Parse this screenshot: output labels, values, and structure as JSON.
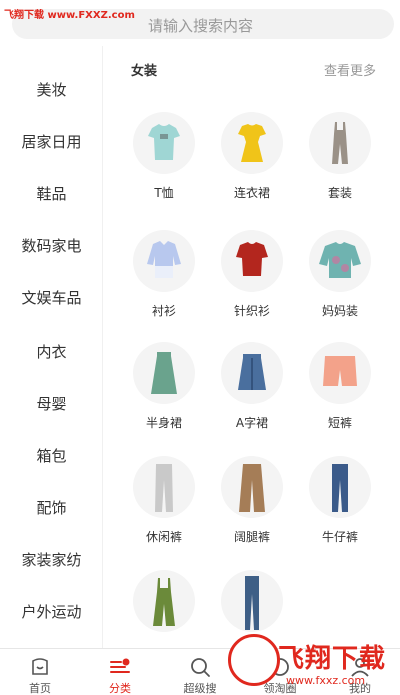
{
  "watermark": "飞翔下载 www.FXXZ.com",
  "search": {
    "placeholder": "请输入搜索内容"
  },
  "sidebar": {
    "items": [
      {
        "label": "美妆"
      },
      {
        "label": "居家日用"
      },
      {
        "label": "鞋品"
      },
      {
        "label": "数码家电"
      },
      {
        "label": "文娱车品"
      },
      {
        "label": "内衣"
      },
      {
        "label": "母婴"
      },
      {
        "label": "箱包"
      },
      {
        "label": "配饰"
      },
      {
        "label": "家装家纺"
      },
      {
        "label": "户外运动"
      }
    ]
  },
  "main": {
    "section_title": "女装",
    "more_label": "查看更多",
    "items": [
      {
        "label": "T恤",
        "icon": "tshirt-icon",
        "color": "#9fd6d4"
      },
      {
        "label": "连衣裙",
        "icon": "dress-icon",
        "color": "#f0c419"
      },
      {
        "label": "套装",
        "icon": "jumpsuit-icon",
        "color": "#9a9187"
      },
      {
        "label": "衬衫",
        "icon": "shirt-icon",
        "color": "#b8c8ee"
      },
      {
        "label": "针织衫",
        "icon": "knit-top-icon",
        "color": "#b3261e"
      },
      {
        "label": "妈妈装",
        "icon": "mom-top-icon",
        "color": "#6fb3b0"
      },
      {
        "label": "半身裙",
        "icon": "skirt-icon",
        "color": "#6aa38d"
      },
      {
        "label": "A字裙",
        "icon": "denim-skirt-icon",
        "color": "#4a6f9e"
      },
      {
        "label": "短裤",
        "icon": "shorts-icon",
        "color": "#f3a28a"
      },
      {
        "label": "休闲裤",
        "icon": "casual-pants-icon",
        "color": "#c9c9c9"
      },
      {
        "label": "阔腿裤",
        "icon": "wide-pants-icon",
        "color": "#a57d57"
      },
      {
        "label": "牛仔裤",
        "icon": "jeans-icon",
        "color": "#3b5b8a"
      },
      {
        "label": "",
        "icon": "overalls-icon",
        "color": "#6b8a3a"
      },
      {
        "label": "",
        "icon": "jeans-icon",
        "color": "#3e5f86"
      }
    ]
  },
  "tabbar": {
    "tabs": [
      {
        "label": "首页",
        "icon": "home-icon"
      },
      {
        "label": "分类",
        "icon": "category-icon"
      },
      {
        "label": "超级搜",
        "icon": "search-icon"
      },
      {
        "label": "领淘圈",
        "icon": "circle-icon"
      },
      {
        "label": "我的",
        "icon": "user-icon"
      }
    ],
    "active_color": "#e0281e"
  },
  "brand_overlay": {
    "text": "飞翔下载",
    "url": "www.fxxz.com"
  }
}
